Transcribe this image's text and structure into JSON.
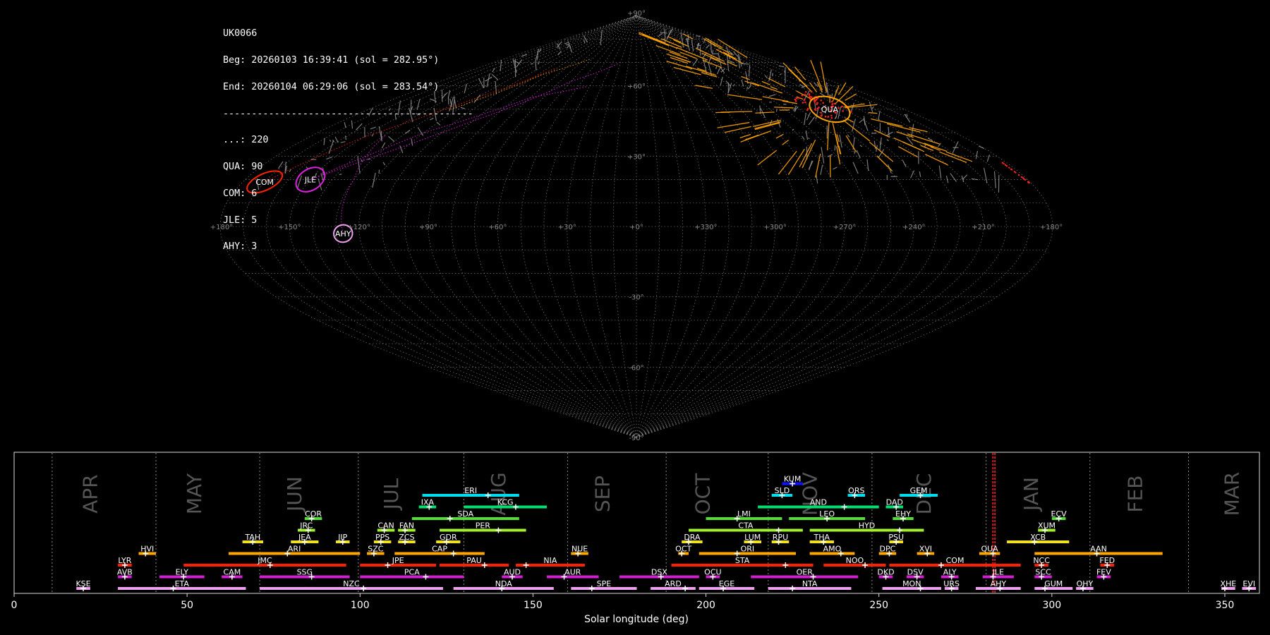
{
  "header": {
    "station": "UK0066",
    "beg": "Beg: 20260103 16:39:41 (sol = 282.95°)",
    "end": "End: 20260104 06:29:06 (sol = 283.54°)",
    "separator": "--------------------------------------------",
    "counts": [
      "...: 220",
      "QUA: 90",
      "COM: 6",
      "JLE: 5",
      "AHY: 3"
    ]
  },
  "colors": {
    "background": "#000000",
    "grid": "#8a8a8a",
    "sporadic": "#9a9a9a",
    "marker": "#ff2020"
  },
  "sky": {
    "ra_labels": [
      "+180°",
      "+150°",
      "+120°",
      "+90°",
      "+60°",
      "+30°",
      "+0°",
      "+330°",
      "+300°",
      "+270°",
      "+240°",
      "+210°",
      "+180°"
    ],
    "dec_labels": [
      "+90°",
      "+60°",
      "+30°",
      "-30°",
      "-60°",
      "-90°"
    ],
    "radiants": [
      {
        "name": "QUA",
        "ra": 230,
        "dec": 50,
        "color": "#ffa500",
        "major": 12,
        "minor": 5,
        "rot": 18
      },
      {
        "name": "COM",
        "ra": 170,
        "dec": 19,
        "color": "#ff2000",
        "major": 11,
        "minor": 3.5,
        "rot": -25
      },
      {
        "name": "JLE",
        "ra": 150,
        "dec": 20,
        "color": "#e020e0",
        "major": 9,
        "minor": 4.5,
        "rot": -32
      },
      {
        "name": "AHY",
        "ra": 127,
        "dec": -3,
        "color": "#f0a0f0",
        "major": 5,
        "minor": 4,
        "rot": 80
      }
    ]
  },
  "chart_data": {
    "type": "timeline",
    "xlabel": "Solar longitude (deg)",
    "xlim": [
      0,
      360
    ],
    "xticks": [
      0,
      50,
      100,
      150,
      200,
      250,
      300,
      350
    ],
    "current_sol": [
      282.95,
      283.54
    ],
    "month_boundaries": [
      11,
      41,
      71,
      99.5,
      130,
      160,
      188.5,
      218,
      248,
      281,
      311,
      339.5
    ],
    "months": [
      {
        "label": "APR",
        "sol": 24
      },
      {
        "label": "MAY",
        "sol": 54
      },
      {
        "label": "JUN",
        "sol": 83
      },
      {
        "label": "JUL",
        "sol": 111
      },
      {
        "label": "AUG",
        "sol": 142
      },
      {
        "label": "SEP",
        "sol": 172
      },
      {
        "label": "OCT",
        "sol": 201
      },
      {
        "label": "NOV",
        "sol": 232
      },
      {
        "label": "DEC",
        "sol": 265
      },
      {
        "label": "JAN",
        "sol": 296
      },
      {
        "label": "FEB",
        "sol": 326
      },
      {
        "label": "MAR",
        "sol": 354
      }
    ],
    "showers": [
      {
        "code": "KUM",
        "start": 222,
        "end": 228,
        "peak": 225,
        "row": 9,
        "color": "#1010ff"
      },
      {
        "code": "ERI",
        "start": 118,
        "end": 146,
        "peak": 137,
        "row": 8,
        "color": "#00ddee"
      },
      {
        "code": "SLD",
        "start": 219,
        "end": 225,
        "peak": 222,
        "row": 8,
        "color": "#00ddee"
      },
      {
        "code": "ORS",
        "start": 241,
        "end": 246,
        "peak": 243,
        "row": 8,
        "color": "#00ddee"
      },
      {
        "code": "GEM",
        "start": 256,
        "end": 267,
        "peak": 262,
        "row": 8,
        "color": "#00ddee"
      },
      {
        "code": "IXA",
        "start": 117,
        "end": 122,
        "peak": 120,
        "row": 7,
        "color": "#00e070"
      },
      {
        "code": "KCG",
        "start": 130,
        "end": 154,
        "peak": 145,
        "row": 7,
        "color": "#00e070"
      },
      {
        "code": "AND",
        "start": 215,
        "end": 250,
        "peak": 240,
        "row": 7,
        "color": "#00e070"
      },
      {
        "code": "DAD",
        "start": 252,
        "end": 257,
        "peak": 255,
        "row": 7,
        "color": "#00e070"
      },
      {
        "code": "COR",
        "start": 84,
        "end": 89,
        "peak": 86,
        "row": 6,
        "color": "#50e030"
      },
      {
        "code": "SDA",
        "start": 115,
        "end": 146,
        "peak": 126,
        "row": 6,
        "color": "#50e030"
      },
      {
        "code": "LMI",
        "start": 200,
        "end": 222,
        "peak": 209,
        "row": 6,
        "color": "#50e030"
      },
      {
        "code": "LEO",
        "start": 224,
        "end": 246,
        "peak": 235,
        "row": 6,
        "color": "#50e030"
      },
      {
        "code": "EHY",
        "start": 254,
        "end": 260,
        "peak": 257,
        "row": 6,
        "color": "#50e030"
      },
      {
        "code": "ECV",
        "start": 300,
        "end": 304,
        "peak": 302,
        "row": 6,
        "color": "#50e030"
      },
      {
        "code": "JRC",
        "start": 82,
        "end": 87,
        "peak": 85,
        "row": 5,
        "color": "#a0f030"
      },
      {
        "code": "CAN",
        "start": 105,
        "end": 110,
        "peak": 107,
        "row": 5,
        "color": "#a0f030"
      },
      {
        "code": "FAN",
        "start": 111,
        "end": 116,
        "peak": 113,
        "row": 5,
        "color": "#a0f030"
      },
      {
        "code": "PER",
        "start": 123,
        "end": 148,
        "peak": 140,
        "row": 5,
        "color": "#a0f030"
      },
      {
        "code": "CTA",
        "start": 195,
        "end": 228,
        "peak": 221,
        "row": 5,
        "color": "#a0f030"
      },
      {
        "code": "HYD",
        "start": 230,
        "end": 263,
        "peak": 256,
        "row": 5,
        "color": "#a0f030"
      },
      {
        "code": "XUM",
        "start": 296,
        "end": 301,
        "peak": 298,
        "row": 5,
        "color": "#a0f030"
      },
      {
        "code": "TAH",
        "start": 66,
        "end": 72,
        "peak": 69,
        "row": 4,
        "color": "#f0e020"
      },
      {
        "code": "JEA",
        "start": 80,
        "end": 88,
        "peak": 84,
        "row": 4,
        "color": "#f0e020"
      },
      {
        "code": "JIP",
        "start": 93,
        "end": 97,
        "peak": 95,
        "row": 4,
        "color": "#f0e020"
      },
      {
        "code": "PPS",
        "start": 104,
        "end": 109,
        "peak": 106,
        "row": 4,
        "color": "#f0e020"
      },
      {
        "code": "ZCS",
        "start": 111,
        "end": 116,
        "peak": 113,
        "row": 4,
        "color": "#f0e020"
      },
      {
        "code": "GDR",
        "start": 122,
        "end": 129,
        "peak": 125,
        "row": 4,
        "color": "#f0e020"
      },
      {
        "code": "DRA",
        "start": 193,
        "end": 199,
        "peak": 195,
        "row": 4,
        "color": "#f0e020"
      },
      {
        "code": "LUM",
        "start": 211,
        "end": 216,
        "peak": 213,
        "row": 4,
        "color": "#f0e020"
      },
      {
        "code": "RPU",
        "start": 219,
        "end": 224,
        "peak": 221,
        "row": 4,
        "color": "#f0e020"
      },
      {
        "code": "THA",
        "start": 230,
        "end": 237,
        "peak": 234,
        "row": 4,
        "color": "#f0e020"
      },
      {
        "code": "PSU",
        "start": 253,
        "end": 257,
        "peak": 255,
        "row": 4,
        "color": "#f0e020"
      },
      {
        "code": "XCB",
        "start": 287,
        "end": 305,
        "peak": 295,
        "row": 4,
        "color": "#f0e020"
      },
      {
        "code": "HVI",
        "start": 36,
        "end": 41,
        "peak": 38,
        "row": 3,
        "color": "#ffa500"
      },
      {
        "code": "ARI",
        "start": 62,
        "end": 100,
        "peak": 79,
        "row": 3,
        "color": "#ffa500"
      },
      {
        "code": "SZC",
        "start": 102,
        "end": 107,
        "peak": 104,
        "row": 3,
        "color": "#ffa500"
      },
      {
        "code": "CAP",
        "start": 110,
        "end": 136,
        "peak": 127,
        "row": 3,
        "color": "#ffa500"
      },
      {
        "code": "NUE",
        "start": 161,
        "end": 166,
        "peak": 163,
        "row": 3,
        "color": "#ffa500"
      },
      {
        "code": "OCT",
        "start": 192,
        "end": 195,
        "peak": 193,
        "row": 3,
        "color": "#ffa500"
      },
      {
        "code": "ORI",
        "start": 198,
        "end": 226,
        "peak": 209,
        "row": 3,
        "color": "#ffa500"
      },
      {
        "code": "AMO",
        "start": 230,
        "end": 243,
        "peak": 239,
        "row": 3,
        "color": "#ffa500"
      },
      {
        "code": "DPC",
        "start": 250,
        "end": 255,
        "peak": 253,
        "row": 3,
        "color": "#ffa500"
      },
      {
        "code": "XVI",
        "start": 261,
        "end": 266,
        "peak": 264,
        "row": 3,
        "color": "#ffa500"
      },
      {
        "code": "QUA",
        "start": 279,
        "end": 285,
        "peak": 283,
        "row": 3,
        "color": "#ffa500"
      },
      {
        "code": "AAN",
        "start": 295,
        "end": 332,
        "peak": 313,
        "row": 3,
        "color": "#ffa500"
      },
      {
        "code": "LYR",
        "start": 30,
        "end": 34,
        "peak": 32,
        "row": 2,
        "color": "#ff2000"
      },
      {
        "code": "JMC",
        "start": 49,
        "end": 96,
        "peak": 74,
        "row": 2,
        "color": "#ff2000"
      },
      {
        "code": "JPE",
        "start": 100,
        "end": 122,
        "peak": 108,
        "row": 2,
        "color": "#ff2000"
      },
      {
        "code": "PAU",
        "start": 123,
        "end": 143,
        "peak": 136,
        "row": 2,
        "color": "#ff2000"
      },
      {
        "code": "NIA",
        "start": 145,
        "end": 165,
        "peak": 148,
        "row": 2,
        "color": "#ff2000"
      },
      {
        "code": "STA",
        "start": 190,
        "end": 231,
        "peak": 223,
        "row": 2,
        "color": "#ff2000"
      },
      {
        "code": "NOO",
        "start": 234,
        "end": 252,
        "peak": 246,
        "row": 2,
        "color": "#ff2000"
      },
      {
        "code": "COM",
        "start": 253,
        "end": 291,
        "peak": 268,
        "row": 2,
        "color": "#ff2000"
      },
      {
        "code": "NCC",
        "start": 295,
        "end": 299,
        "peak": 297,
        "row": 2,
        "color": "#ff2000"
      },
      {
        "code": "FED",
        "start": 314,
        "end": 318,
        "peak": 316,
        "row": 2,
        "color": "#ff2000"
      },
      {
        "code": "AVB",
        "start": 30,
        "end": 34,
        "peak": 32,
        "row": 1,
        "color": "#d020d0"
      },
      {
        "code": "ELY",
        "start": 42,
        "end": 55,
        "peak": 49,
        "row": 1,
        "color": "#d020d0"
      },
      {
        "code": "CAM",
        "start": 60,
        "end": 66,
        "peak": 63,
        "row": 1,
        "color": "#d020d0"
      },
      {
        "code": "SSG",
        "start": 71,
        "end": 97,
        "peak": 86,
        "row": 1,
        "color": "#d020d0"
      },
      {
        "code": "PCA",
        "start": 100,
        "end": 130,
        "peak": 119,
        "row": 1,
        "color": "#d020d0"
      },
      {
        "code": "AUD",
        "start": 141,
        "end": 147,
        "peak": 144,
        "row": 1,
        "color": "#d020d0"
      },
      {
        "code": "AUR",
        "start": 154,
        "end": 169,
        "peak": 159,
        "row": 1,
        "color": "#d020d0"
      },
      {
        "code": "DSX",
        "start": 175,
        "end": 198,
        "peak": 187,
        "row": 1,
        "color": "#d020d0"
      },
      {
        "code": "OCU",
        "start": 200,
        "end": 204,
        "peak": 202,
        "row": 1,
        "color": "#d020d0"
      },
      {
        "code": "OER",
        "start": 213,
        "end": 244,
        "peak": 231,
        "row": 1,
        "color": "#d020d0"
      },
      {
        "code": "DKD",
        "start": 250,
        "end": 254,
        "peak": 252,
        "row": 1,
        "color": "#d020d0"
      },
      {
        "code": "DSV",
        "start": 258,
        "end": 263,
        "peak": 261,
        "row": 1,
        "color": "#d020d0"
      },
      {
        "code": "ALY",
        "start": 268,
        "end": 273,
        "peak": 271,
        "row": 1,
        "color": "#d020d0"
      },
      {
        "code": "JLE",
        "start": 280,
        "end": 289,
        "peak": 283,
        "row": 1,
        "color": "#d020d0"
      },
      {
        "code": "SCC",
        "start": 295,
        "end": 300,
        "peak": 297,
        "row": 1,
        "color": "#d020d0"
      },
      {
        "code": "FEV",
        "start": 313,
        "end": 317,
        "peak": 315,
        "row": 1,
        "color": "#d020d0"
      },
      {
        "code": "KSE",
        "start": 18,
        "end": 22,
        "peak": 20,
        "row": 0,
        "color": "#f0a0f0"
      },
      {
        "code": "ETA",
        "start": 30,
        "end": 67,
        "peak": 46,
        "row": 0,
        "color": "#f0a0f0"
      },
      {
        "code": "NZC",
        "start": 71,
        "end": 124,
        "peak": 101,
        "row": 0,
        "color": "#f0a0f0"
      },
      {
        "code": "NDA",
        "start": 127,
        "end": 156,
        "peak": 141,
        "row": 0,
        "color": "#f0a0f0"
      },
      {
        "code": "SPE",
        "start": 161,
        "end": 180,
        "peak": 167,
        "row": 0,
        "color": "#f0a0f0"
      },
      {
        "code": "ARD",
        "start": 184,
        "end": 197,
        "peak": 194,
        "row": 0,
        "color": "#f0a0f0"
      },
      {
        "code": "EGE",
        "start": 198,
        "end": 214,
        "peak": 205,
        "row": 0,
        "color": "#f0a0f0"
      },
      {
        "code": "NTA",
        "start": 218,
        "end": 242,
        "peak": 225,
        "row": 0,
        "color": "#f0a0f0"
      },
      {
        "code": "MON",
        "start": 251,
        "end": 268,
        "peak": 262,
        "row": 0,
        "color": "#f0a0f0"
      },
      {
        "code": "URS",
        "start": 269,
        "end": 273,
        "peak": 271,
        "row": 0,
        "color": "#f0a0f0"
      },
      {
        "code": "AHY",
        "start": 278,
        "end": 291,
        "peak": 285,
        "row": 0,
        "color": "#f0a0f0"
      },
      {
        "code": "GUM",
        "start": 295,
        "end": 306,
        "peak": 298,
        "row": 0,
        "color": "#f0a0f0"
      },
      {
        "code": "OHY",
        "start": 307,
        "end": 312,
        "peak": 309,
        "row": 0,
        "color": "#f0a0f0"
      },
      {
        "code": "XHE",
        "start": 349,
        "end": 353,
        "peak": 350,
        "row": 0,
        "color": "#f0a0f0"
      },
      {
        "code": "EVI",
        "start": 355,
        "end": 359,
        "peak": 357,
        "row": 0,
        "color": "#f0a0f0"
      }
    ]
  }
}
